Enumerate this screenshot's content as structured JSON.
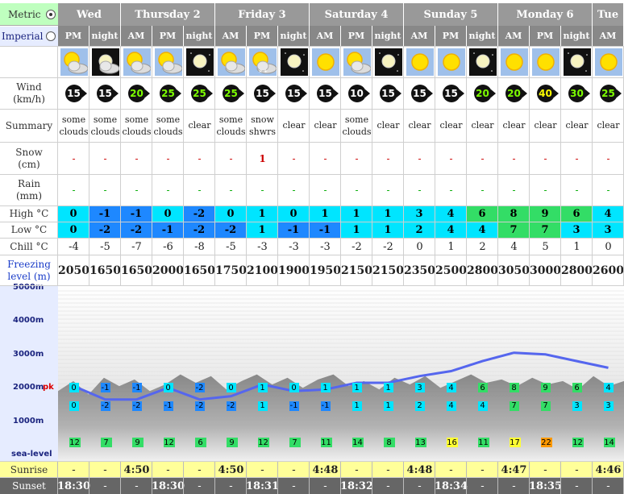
{
  "units": {
    "metric_label": "Metric",
    "imperial_label": "Imperial",
    "selected": "metric"
  },
  "days": [
    {
      "name": "Wed",
      "periods": 2
    },
    {
      "name": "Thursday 2",
      "periods": 3
    },
    {
      "name": "Friday 3",
      "periods": 3
    },
    {
      "name": "Saturday 4",
      "periods": 3
    },
    {
      "name": "Sunday 5",
      "periods": 3
    },
    {
      "name": "Monday 6",
      "periods": 3
    },
    {
      "name": "Tue",
      "periods": 1
    }
  ],
  "periods": [
    "PM",
    "night",
    "AM",
    "PM",
    "night",
    "AM",
    "PM",
    "night",
    "AM",
    "PM",
    "night",
    "AM",
    "PM",
    "night",
    "AM",
    "PM",
    "night",
    "AM"
  ],
  "icons": [
    "partly-cloudy-sun",
    "cloudy-moon",
    "partly-cloudy-sun",
    "partly-cloudy-sun",
    "clear-night",
    "partly-cloudy-sun",
    "snow-showers",
    "clear-night",
    "sun",
    "partly-cloudy-sun",
    "clear-night",
    "sun",
    "sun",
    "clear-night",
    "sun",
    "sun",
    "clear-night",
    "sun"
  ],
  "row_labels": {
    "wind": "Wind",
    "wind_unit": "(km/h)",
    "summary": "Summary",
    "snow": "Snow",
    "snow_unit": "(cm)",
    "rain": "Rain",
    "rain_unit": "(mm)",
    "high": "High °C",
    "low": "Low °C",
    "chill": "Chill °C",
    "freezing": "Freezing",
    "freezing_unit": "level (m)",
    "sunrise": "Sunrise",
    "sunset": "Sunset"
  },
  "wind": [
    "15",
    "15",
    "20",
    "25",
    "25",
    "25",
    "15",
    "15",
    "15",
    "10",
    "15",
    "15",
    "15",
    "20",
    "20",
    "40",
    "30",
    "25"
  ],
  "wind_colors": [
    "#fff",
    "#fff",
    "#7CFC00",
    "#7CFC00",
    "#7CFC00",
    "#7CFC00",
    "#fff",
    "#fff",
    "#fff",
    "#fff",
    "#fff",
    "#fff",
    "#fff",
    "#7CFC00",
    "#7CFC00",
    "#ffff00",
    "#7CFC00",
    "#7CFC00"
  ],
  "summary": [
    "some clouds",
    "some clouds",
    "some clouds",
    "some clouds",
    "clear",
    "some clouds",
    "snow shwrs",
    "clear",
    "clear",
    "some clouds",
    "clear",
    "clear",
    "clear",
    "clear",
    "clear",
    "clear",
    "clear",
    "clear"
  ],
  "snow": [
    "-",
    "-",
    "-",
    "-",
    "-",
    "-",
    "1",
    "-",
    "-",
    "-",
    "-",
    "-",
    "-",
    "-",
    "-",
    "-",
    "-",
    "-"
  ],
  "rain": [
    "-",
    "-",
    "-",
    "-",
    "-",
    "-",
    "-",
    "-",
    "-",
    "-",
    "-",
    "-",
    "-",
    "-",
    "-",
    "-",
    "-",
    "-"
  ],
  "high": [
    "0",
    "-1",
    "-1",
    "0",
    "-2",
    "0",
    "1",
    "0",
    "1",
    "1",
    "1",
    "3",
    "4",
    "6",
    "8",
    "9",
    "6",
    "4"
  ],
  "low": [
    "0",
    "-2",
    "-2",
    "-1",
    "-2",
    "-2",
    "1",
    "-1",
    "-1",
    "1",
    "1",
    "2",
    "4",
    "4",
    "7",
    "7",
    "3",
    "3"
  ],
  "chill": [
    "-4",
    "-5",
    "-7",
    "-6",
    "-8",
    "-5",
    "-3",
    "-3",
    "-3",
    "-2",
    "-2",
    "0",
    "1",
    "2",
    "4",
    "5",
    "1",
    "0"
  ],
  "freezing": [
    "2050",
    "1650",
    "1650",
    "2000",
    "1650",
    "1750",
    "2100",
    "1900",
    "1950",
    "2150",
    "2150",
    "2350",
    "2500",
    "2800",
    "3050",
    "3000",
    "2800",
    "2600"
  ],
  "sunrise": [
    "-",
    "-",
    "4:50",
    "-",
    "-",
    "4:50",
    "-",
    "-",
    "4:48",
    "-",
    "-",
    "4:48",
    "-",
    "-",
    "4:47",
    "-",
    "-",
    "4:46"
  ],
  "sunset": [
    "18:30",
    "-",
    "-",
    "18:30",
    "-",
    "-",
    "18:31",
    "-",
    "-",
    "18:32",
    "-",
    "-",
    "18:34",
    "-",
    "-",
    "18:35",
    "-",
    "-"
  ],
  "chart": {
    "y_labels": [
      "5000m",
      "4000m",
      "3000m",
      "2000m",
      "1000m",
      "sea-level"
    ],
    "pk_label": "pk",
    "bottom_values": [
      "12",
      "7",
      "9",
      "12",
      "6",
      "9",
      "12",
      "7",
      "11",
      "14",
      "8",
      "13",
      "16",
      "11",
      "17",
      "22",
      "12",
      "14"
    ]
  }
}
